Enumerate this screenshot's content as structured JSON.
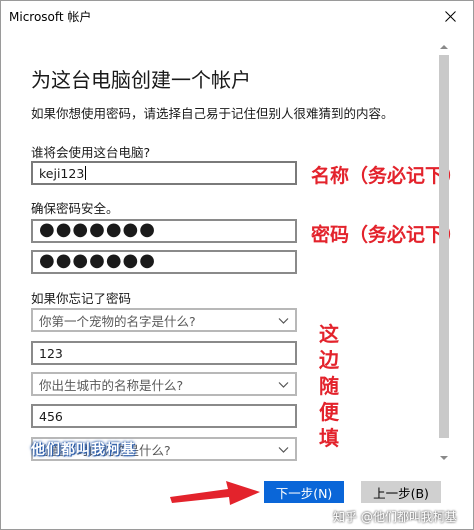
{
  "window": {
    "title": "Microsoft 帐户"
  },
  "form": {
    "heading": "为这台电脑创建一个帐户",
    "description": "如果你想使用密码，请选择自己易于记住但别人很难猜到的内容。",
    "username_label": "谁将会使用这台电脑?",
    "username_value": "keji123",
    "password_label": "确保密码安全。",
    "password_dots": "●●●●●●●",
    "confirm_dots": "●●●●●●●",
    "hint_label": "如果你忘记了密码",
    "q1_placeholder": "你第一个宠物的名字是什么?",
    "a1_value": "123",
    "q2_placeholder": "你出生城市的名称是什么?",
    "a2_value": "456",
    "q3_placeholder": "你童年时的昵称是什么?"
  },
  "annotations": {
    "name_note": "名称（务必记下）",
    "password_note": "密码（务必记下）",
    "side_note_chars": [
      "这",
      "边",
      "随",
      "便",
      "填"
    ],
    "watermark": "他们都叫我柯基"
  },
  "buttons": {
    "next_label": "下一步(N)",
    "back_label": "上一步(B)"
  },
  "attribution": "知乎 @他们都叫我柯基",
  "colors": {
    "accent": "#0a66d8",
    "annotation": "#e3232c"
  }
}
